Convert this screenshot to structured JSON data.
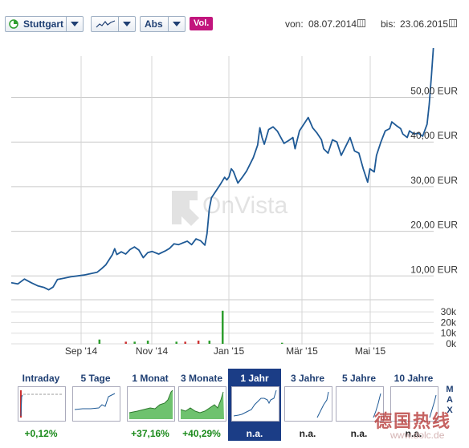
{
  "toolbar": {
    "exchange": "Stuttgart",
    "chart_type_icon": "line-chart-icon",
    "scale": "Abs",
    "volume_toggle": "Vol.",
    "from_label": "von:",
    "from_date": "08.07.2014",
    "to_label": "bis:",
    "to_date": "23.06.2015",
    "calendar_icon": "calendar-icon"
  },
  "watermark": "OnVista",
  "colors": {
    "line": "#1f5a96",
    "volume_green": "#2e9e2e",
    "volume_red": "#cc3333",
    "selected_tab": "#1b3d86",
    "vol_button": "#c2157d"
  },
  "chart_data": {
    "type": "line",
    "series": [
      {
        "values": [
          [
            0,
            8.5
          ],
          [
            3,
            8.2
          ],
          [
            6,
            9.3
          ],
          [
            9,
            8.5
          ],
          [
            12,
            7.8
          ],
          [
            15,
            7.4
          ],
          [
            17,
            6.9
          ],
          [
            19,
            7.5
          ],
          [
            21,
            9.2
          ],
          [
            24,
            9.5
          ],
          [
            27,
            9.8
          ],
          [
            30,
            10.0
          ],
          [
            33,
            10.2
          ],
          [
            36,
            10.5
          ],
          [
            39,
            10.8
          ],
          [
            41,
            11.6
          ],
          [
            43,
            12.5
          ],
          [
            46,
            14.8
          ],
          [
            47,
            16.1
          ],
          [
            48,
            14.8
          ],
          [
            50,
            15.4
          ],
          [
            52,
            14.9
          ],
          [
            54,
            15.9
          ],
          [
            56,
            16.5
          ],
          [
            58,
            15.8
          ],
          [
            60,
            14.1
          ],
          [
            62,
            15.2
          ],
          [
            64,
            15.5
          ],
          [
            67,
            14.9
          ],
          [
            70,
            15.6
          ],
          [
            72,
            16.2
          ],
          [
            74,
            17.2
          ],
          [
            76,
            17.0
          ],
          [
            78,
            17.4
          ],
          [
            80,
            17.8
          ],
          [
            82,
            17.0
          ],
          [
            84,
            18.3
          ],
          [
            86,
            17.9
          ],
          [
            88,
            16.9
          ],
          [
            89,
            19.5
          ],
          [
            90,
            25.0
          ],
          [
            91,
            27.5
          ],
          [
            93,
            29.0
          ],
          [
            95,
            30.5
          ],
          [
            96,
            31.3
          ],
          [
            97,
            32.1
          ],
          [
            98,
            31.5
          ],
          [
            99,
            32.2
          ],
          [
            100,
            34.0
          ],
          [
            101,
            33.4
          ],
          [
            103,
            30.8
          ],
          [
            105,
            32.1
          ],
          [
            107,
            33.5
          ],
          [
            110,
            36.5
          ],
          [
            112,
            39.3
          ],
          [
            113,
            43.2
          ],
          [
            114,
            41.0
          ],
          [
            115,
            39.5
          ],
          [
            117,
            42.8
          ],
          [
            119,
            43.4
          ],
          [
            121,
            42.4
          ],
          [
            122,
            41.5
          ],
          [
            124,
            39.7
          ],
          [
            126,
            40.3
          ],
          [
            128,
            41.0
          ],
          [
            129,
            38.5
          ],
          [
            131,
            42.5
          ],
          [
            133,
            44.0
          ],
          [
            135,
            45.5
          ],
          [
            137,
            43.2
          ],
          [
            139,
            42.0
          ],
          [
            141,
            40.5
          ],
          [
            142,
            38.5
          ],
          [
            144,
            37.5
          ],
          [
            146,
            40.5
          ],
          [
            148,
            40.0
          ],
          [
            150,
            37.0
          ],
          [
            152,
            39.0
          ],
          [
            154,
            41.0
          ],
          [
            156,
            38.0
          ],
          [
            158,
            37.5
          ],
          [
            160,
            34.0
          ],
          [
            162,
            31.0
          ],
          [
            163,
            34.0
          ],
          [
            165,
            33.3
          ],
          [
            166,
            37.0
          ],
          [
            168,
            40.0
          ],
          [
            170,
            42.5
          ],
          [
            172,
            43.0
          ],
          [
            173,
            44.5
          ],
          [
            175,
            43.7
          ],
          [
            177,
            43.0
          ],
          [
            178,
            41.8
          ],
          [
            180,
            41.0
          ],
          [
            181,
            42.5
          ],
          [
            183,
            41.8
          ],
          [
            185,
            42.0
          ],
          [
            187,
            41.3
          ],
          [
            189,
            44.0
          ],
          [
            190,
            48.5
          ],
          [
            191,
            55.0
          ],
          [
            192,
            62.0
          ]
        ]
      }
    ],
    "volume": [
      {
        "x": 40,
        "v": 4,
        "color": "green"
      },
      {
        "x": 52,
        "v": 2,
        "color": "red"
      },
      {
        "x": 56,
        "v": 2,
        "color": "green"
      },
      {
        "x": 62,
        "v": 3,
        "color": "green"
      },
      {
        "x": 75,
        "v": 2,
        "color": "green"
      },
      {
        "x": 79,
        "v": 2,
        "color": "red"
      },
      {
        "x": 85,
        "v": 3,
        "color": "red"
      },
      {
        "x": 90,
        "v": 3,
        "color": "green"
      },
      {
        "x": 96,
        "v": 31,
        "color": "green"
      },
      {
        "x": 123,
        "v": 1,
        "color": "green"
      }
    ],
    "x_ticks": [
      "Sep '14",
      "Nov '14",
      "Jan '15",
      "Mär '15",
      "Mai '15"
    ],
    "y_ticks": [
      "10,00 EUR",
      "20,00 EUR",
      "30,00 EUR",
      "40,00 EUR",
      "50,00 EUR"
    ],
    "volume_ticks": [
      "0k",
      "10k",
      "20k",
      "30k"
    ],
    "ylim": [
      0,
      60
    ],
    "volume_ylim": [
      0,
      30
    ],
    "grid": true
  },
  "periods": [
    {
      "label": "Intraday",
      "value": "+0,12%"
    },
    {
      "label": "5 Tage",
      "value": ""
    },
    {
      "label": "1 Monat",
      "value": "+37,16%"
    },
    {
      "label": "3 Monate",
      "value": "+40,29%"
    },
    {
      "label": "1 Jahr",
      "value": "n.a.",
      "selected": true
    },
    {
      "label": "3 Jahre",
      "value": "n.a."
    },
    {
      "label": "5 Jahre",
      "value": "n.a."
    },
    {
      "label": "10 Jahre",
      "value": "n.a."
    }
  ],
  "max_link": "MAX",
  "site_watermark": "德国热线",
  "site_url": "www.dolc.de"
}
